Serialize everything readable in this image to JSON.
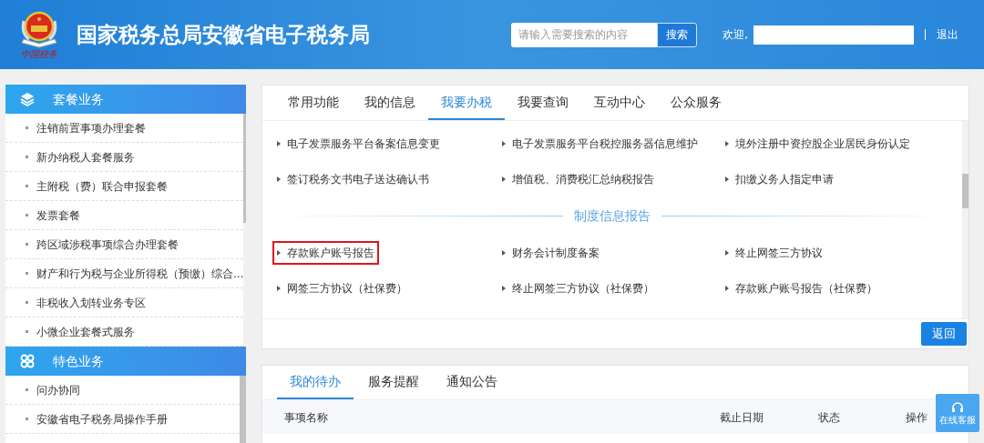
{
  "header": {
    "title": "国家税务总局安徽省电子税务局",
    "logo_text": "中国税务",
    "search": {
      "placeholder": "请输入需要搜索的内容",
      "button": "搜索"
    },
    "welcome": "欢迎,",
    "logout": "退出"
  },
  "sidebar": {
    "sections": [
      {
        "title": "套餐业务",
        "kind": "layers",
        "items": [
          "注销前置事项办理套餐",
          "新办纳税人套餐服务",
          "主附税（费）联合申报套餐",
          "发票套餐",
          "跨区域涉税事项综合办理套餐",
          "财产和行为税与企业所得税（预缴）综合...",
          "非税收入划转业务专区",
          "小微企业套餐式服务"
        ]
      },
      {
        "title": "特色业务",
        "kind": "clover",
        "items": [
          "问办协同",
          "安徽省电子税务局操作手册"
        ]
      }
    ]
  },
  "main": {
    "tabs": [
      {
        "label": "常用功能",
        "selected": false
      },
      {
        "label": "我的信息",
        "selected": false
      },
      {
        "label": "我要办税",
        "selected": true
      },
      {
        "label": "我要查询",
        "selected": false
      },
      {
        "label": "互动中心",
        "selected": false
      },
      {
        "label": "公众服务",
        "selected": false
      }
    ],
    "groups": [
      {
        "items": [
          {
            "label": "电子发票服务平台备案信息变更",
            "highlighted": false
          },
          {
            "label": "电子发票服务平台税控服务器信息维护",
            "highlighted": false
          },
          {
            "label": "境外注册中资控股企业居民身份认定",
            "highlighted": false
          },
          {
            "label": "签订税务文书电子送达确认书",
            "highlighted": false
          },
          {
            "label": "增值税、消费税汇总纳税报告",
            "highlighted": false
          },
          {
            "label": "扣缴义务人指定申请",
            "highlighted": false
          }
        ]
      },
      {
        "title": "制度信息报告",
        "items": [
          {
            "label": "存款账户账号报告",
            "highlighted": true
          },
          {
            "label": "财务会计制度备案",
            "highlighted": false
          },
          {
            "label": "终止网签三方协议",
            "highlighted": false
          },
          {
            "label": "网签三方协议（社保费）",
            "highlighted": false
          },
          {
            "label": "终止网签三方协议（社保费）",
            "highlighted": false
          },
          {
            "label": "存款账户账号报告（社保费）",
            "highlighted": false
          }
        ]
      }
    ],
    "back_button": "返回"
  },
  "tasks": {
    "tabs": [
      {
        "label": "我的待办",
        "selected": true
      },
      {
        "label": "服务提醒",
        "selected": false
      },
      {
        "label": "通知公告",
        "selected": false
      }
    ],
    "columns": [
      "事项名称",
      "截止日期",
      "状态",
      "操作"
    ]
  },
  "service_button": "在线客服"
}
